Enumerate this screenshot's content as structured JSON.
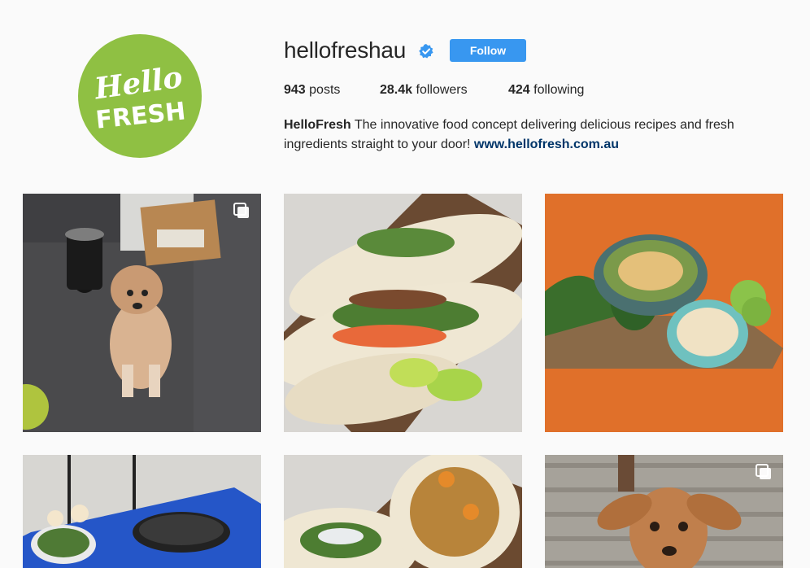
{
  "profile": {
    "avatar_text_line1": "Hello",
    "avatar_text_line2": "FRESH",
    "username": "hellofreshau",
    "verified_icon": "verified-badge-icon",
    "follow_label": "Follow"
  },
  "stats": {
    "posts_count": "943",
    "posts_label": " posts",
    "followers_count": "28.4k",
    "followers_label": " followers",
    "following_count": "424",
    "following_label": " following"
  },
  "bio": {
    "name": "HelloFresh",
    "text": " The innovative food concept delivering delicious recipes and fresh ingredients straight to your door! ",
    "link": "www.hellofresh.com.au"
  },
  "colors": {
    "accent": "#3897f0",
    "avatar_green": "#8fc043",
    "link": "#003569"
  },
  "posts": [
    {
      "subject": "dog in office",
      "multi": true
    },
    {
      "subject": "tacos with lime"
    },
    {
      "subject": "salad bowls on orange table"
    },
    {
      "subject": "kitchen on blue bench"
    },
    {
      "subject": "chickpea tacos"
    },
    {
      "subject": "puppy on deck",
      "multi": true
    }
  ]
}
